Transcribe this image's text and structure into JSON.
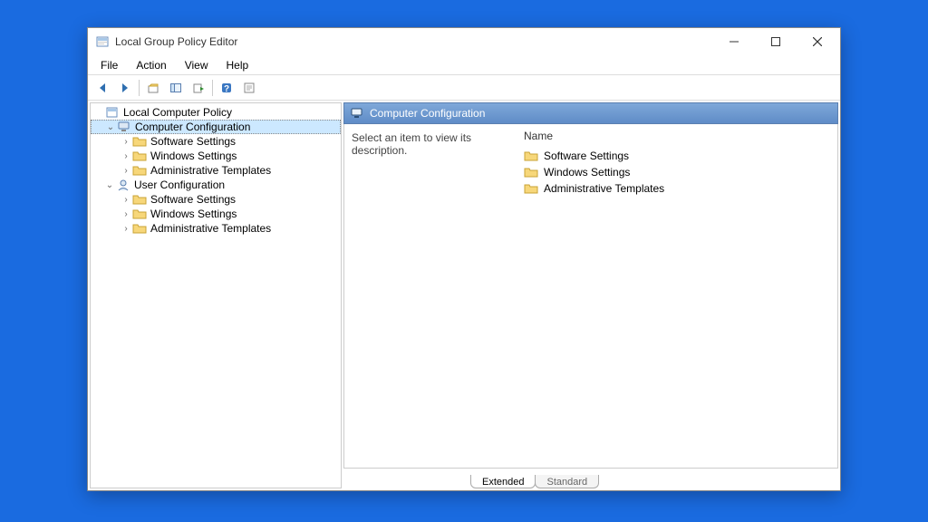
{
  "window": {
    "title": "Local Group Policy Editor"
  },
  "menu": {
    "file": "File",
    "action": "Action",
    "view": "View",
    "help": "Help"
  },
  "tree": {
    "root": "Local Computer Policy",
    "computer_config": "Computer Configuration",
    "cc_software": "Software Settings",
    "cc_windows": "Windows Settings",
    "cc_admin": "Administrative Templates",
    "user_config": "User Configuration",
    "uc_software": "Software Settings",
    "uc_windows": "Windows Settings",
    "uc_admin": "Administrative Templates"
  },
  "detail": {
    "header": "Computer Configuration",
    "description": "Select an item to view its description.",
    "col_name": "Name",
    "items": {
      "software": "Software Settings",
      "windows": "Windows Settings",
      "admin": "Administrative Templates"
    }
  },
  "tabs": {
    "extended": "Extended",
    "standard": "Standard"
  }
}
